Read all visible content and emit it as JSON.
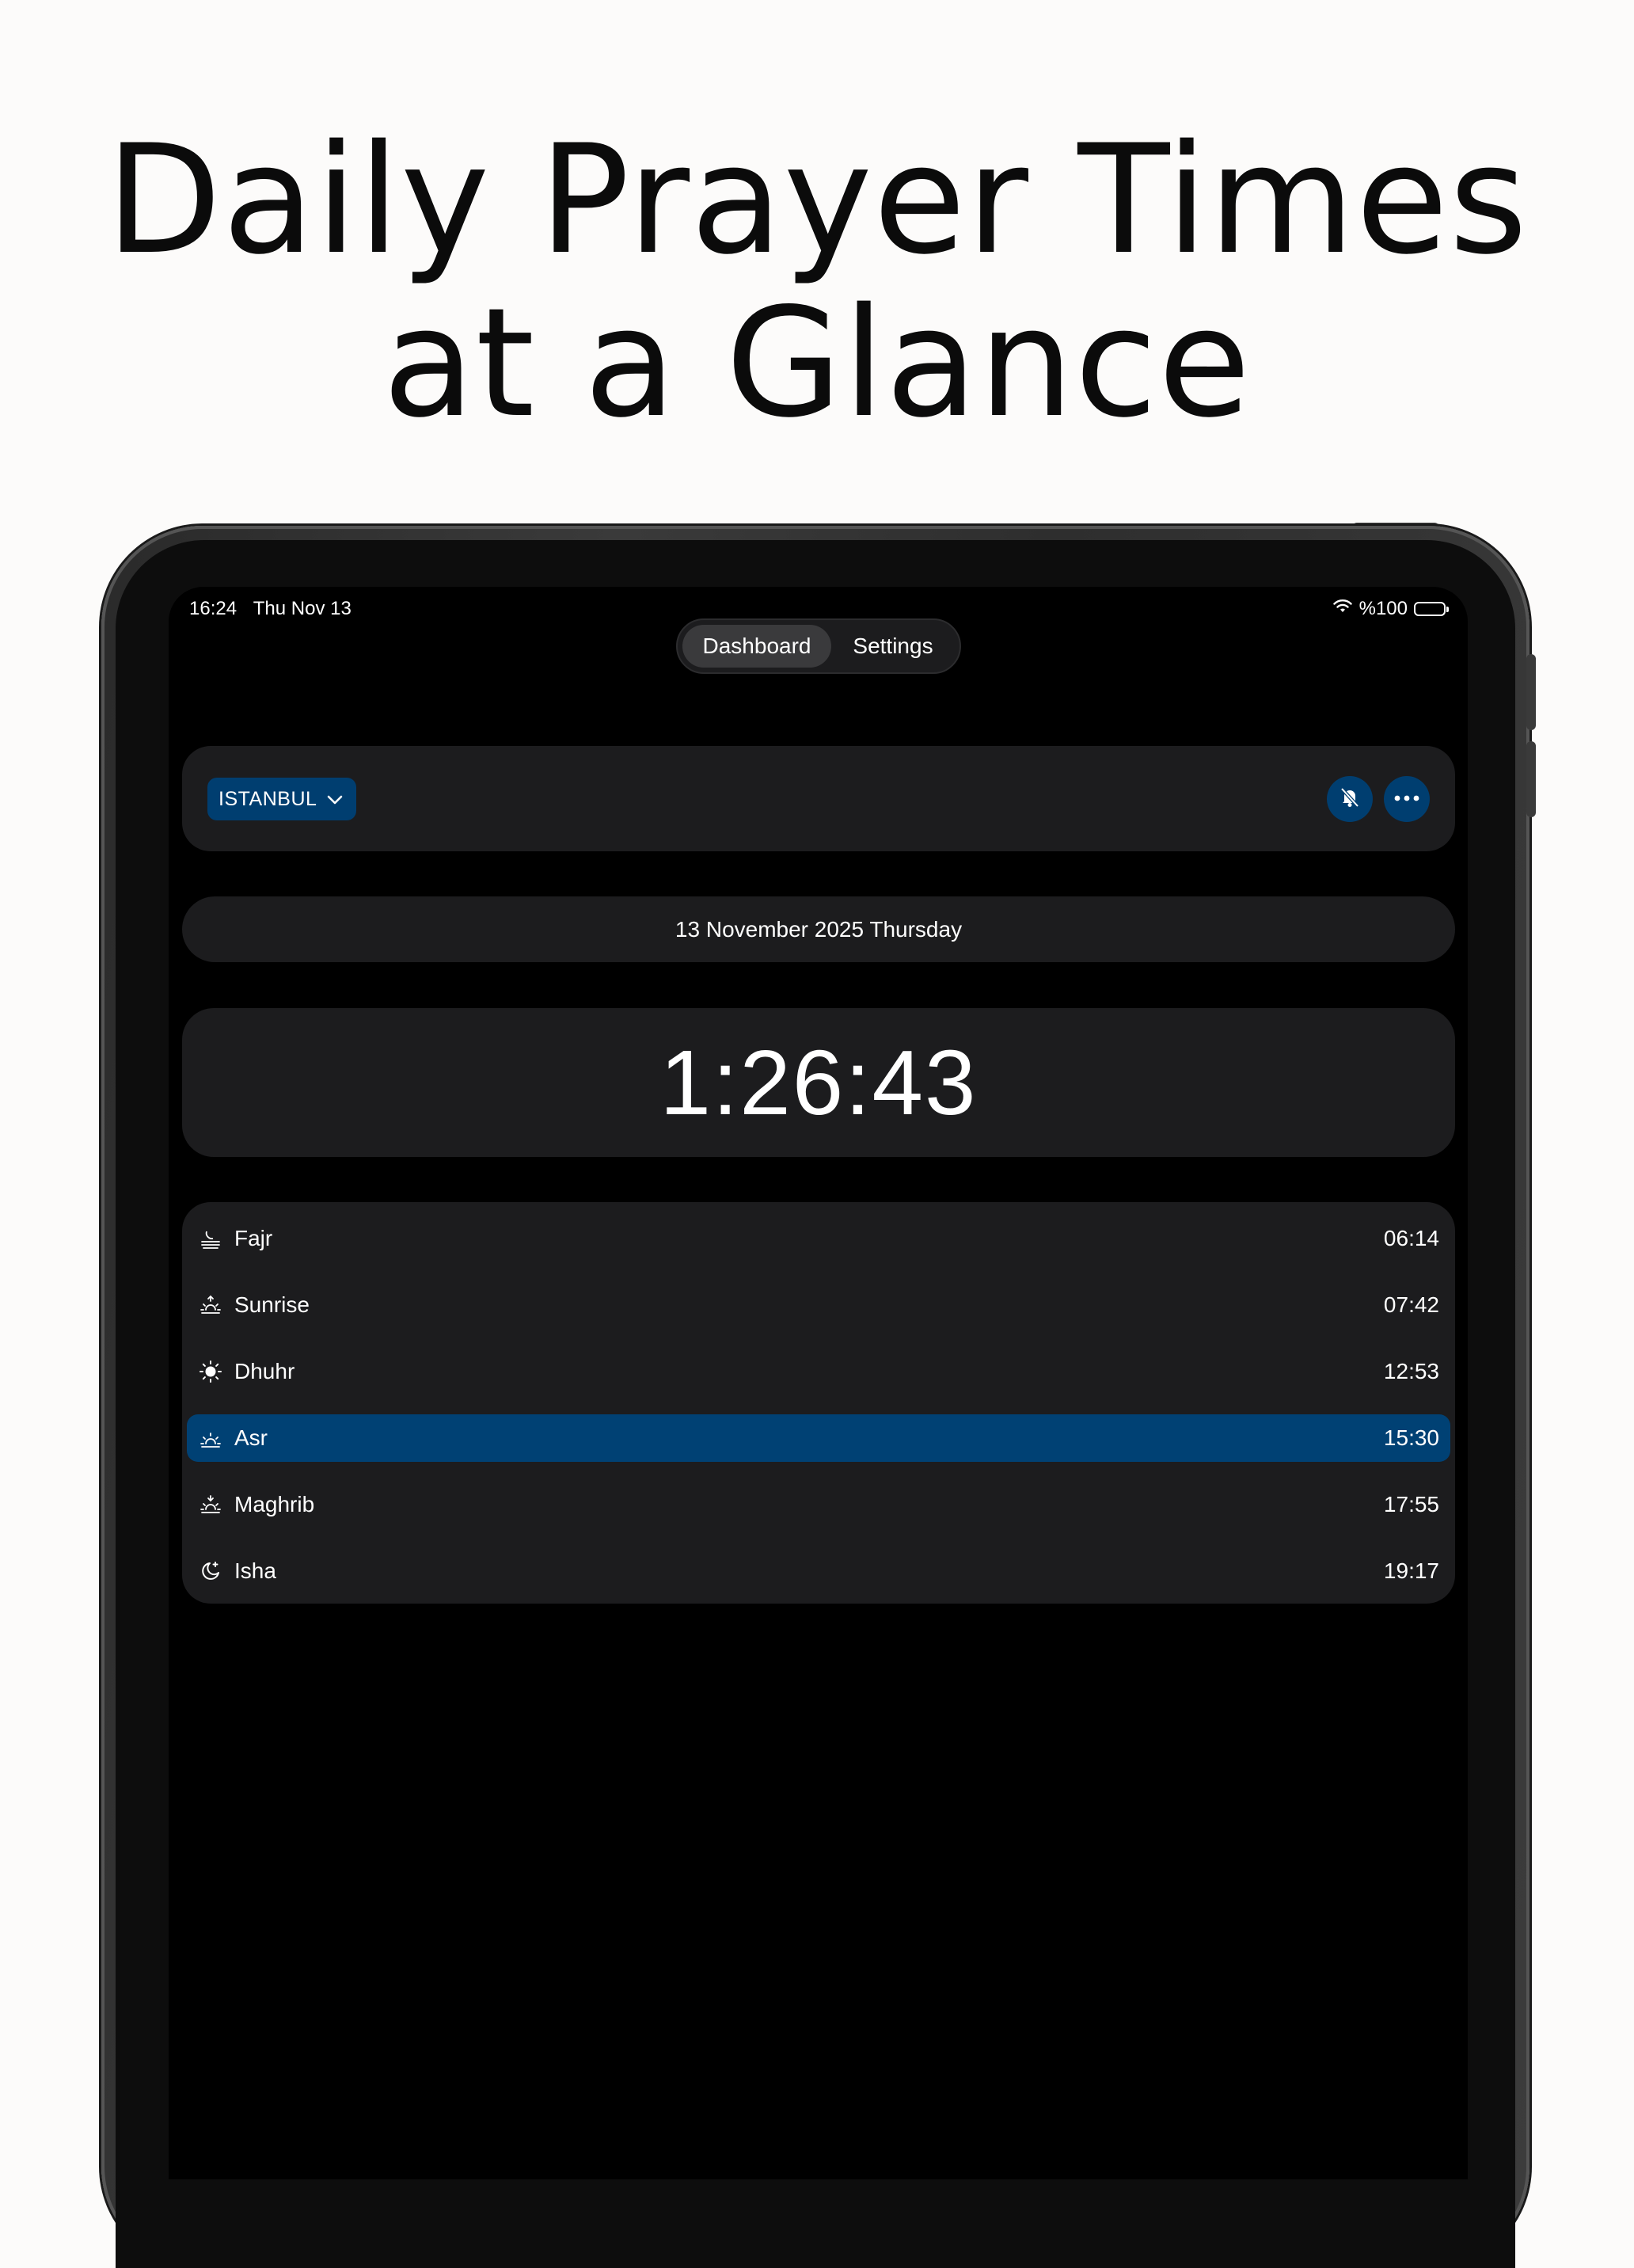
{
  "headline": {
    "line1": "Daily Prayer Times",
    "line2": "at a Glance"
  },
  "status_bar": {
    "time": "16:24",
    "date": "Thu Nov 13",
    "battery": "%100"
  },
  "tabs": [
    {
      "label": "Dashboard",
      "selected": true
    },
    {
      "label": "Settings",
      "selected": false
    }
  ],
  "location": {
    "city": "ISTANBUL"
  },
  "date_label": "13 November 2025 Thursday",
  "countdown": "1:26:43",
  "prayers": [
    {
      "name": "Fajr",
      "time": "06:14",
      "icon": "fajr-icon",
      "active": false
    },
    {
      "name": "Sunrise",
      "time": "07:42",
      "icon": "sunrise-icon",
      "active": false
    },
    {
      "name": "Dhuhr",
      "time": "12:53",
      "icon": "sun-icon",
      "active": false
    },
    {
      "name": "Asr",
      "time": "15:30",
      "icon": "asr-icon",
      "active": true
    },
    {
      "name": "Maghrib",
      "time": "17:55",
      "icon": "sunset-icon",
      "active": false
    },
    {
      "name": "Isha",
      "time": "19:17",
      "icon": "moon-icon",
      "active": false
    }
  ],
  "colors": {
    "accent": "#004174",
    "card": "#1c1c1e",
    "screen": "#000000",
    "page": "#fcfbfa"
  }
}
